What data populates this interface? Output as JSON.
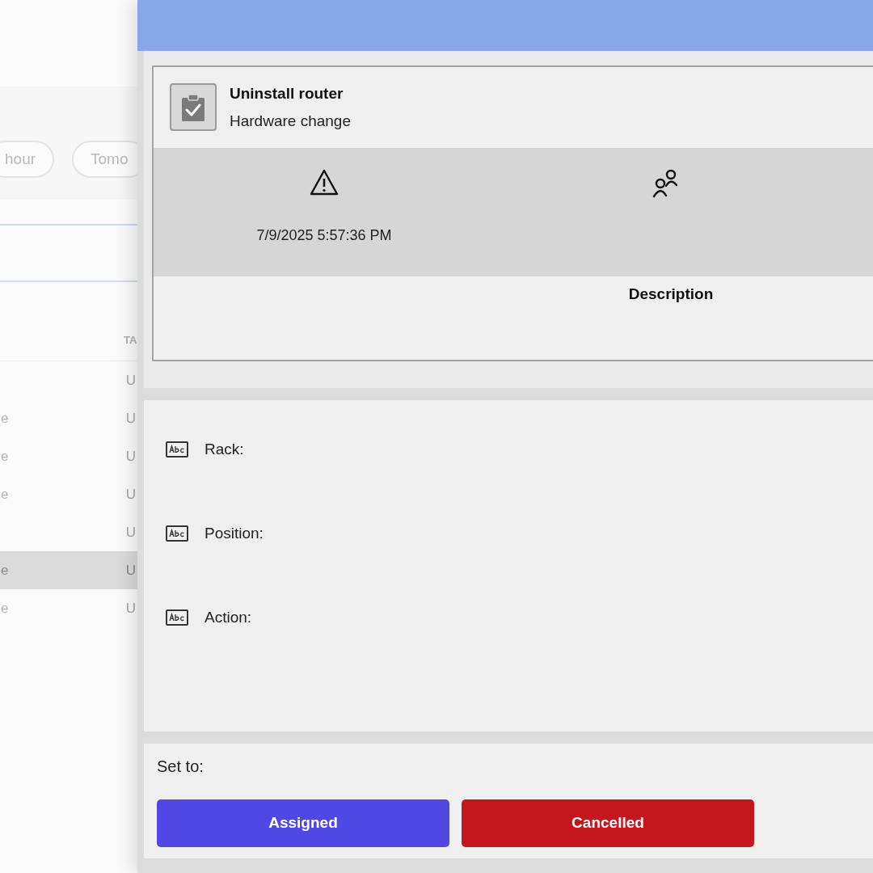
{
  "background_page": {
    "filter_chips": [
      "hour",
      "Tomo"
    ],
    "table": {
      "column_2_header": "TA",
      "rows": [
        {
          "column_2": "U",
          "selected": false
        },
        {
          "column_1": "e",
          "column_2": "U",
          "selected": false
        },
        {
          "column_1": "e",
          "column_2": "U",
          "selected": false
        },
        {
          "column_1": "e",
          "column_2": "U",
          "selected": false
        },
        {
          "column_2": "U",
          "selected": false
        },
        {
          "column_1": "e",
          "column_2": "U",
          "selected": true
        },
        {
          "column_1": "e",
          "column_2": "U",
          "selected": false
        }
      ]
    }
  },
  "task_panel": {
    "card": {
      "title": "Uninstall router",
      "subtitle": "Hardware change",
      "details": [
        {
          "kind": "warning",
          "text": "7/9/2025 5:57:36 PM"
        },
        {
          "kind": "people"
        }
      ],
      "description_label": "Description"
    },
    "fields": [
      {
        "label": "Rack:"
      },
      {
        "label": "Position:"
      },
      {
        "label": "Action:"
      }
    ],
    "status_actions": {
      "label": "Set to:",
      "buttons": [
        {
          "label": "Assigned",
          "color": "#5048e5"
        },
        {
          "label": "Cancelled",
          "color": "#c4161c"
        }
      ]
    }
  }
}
